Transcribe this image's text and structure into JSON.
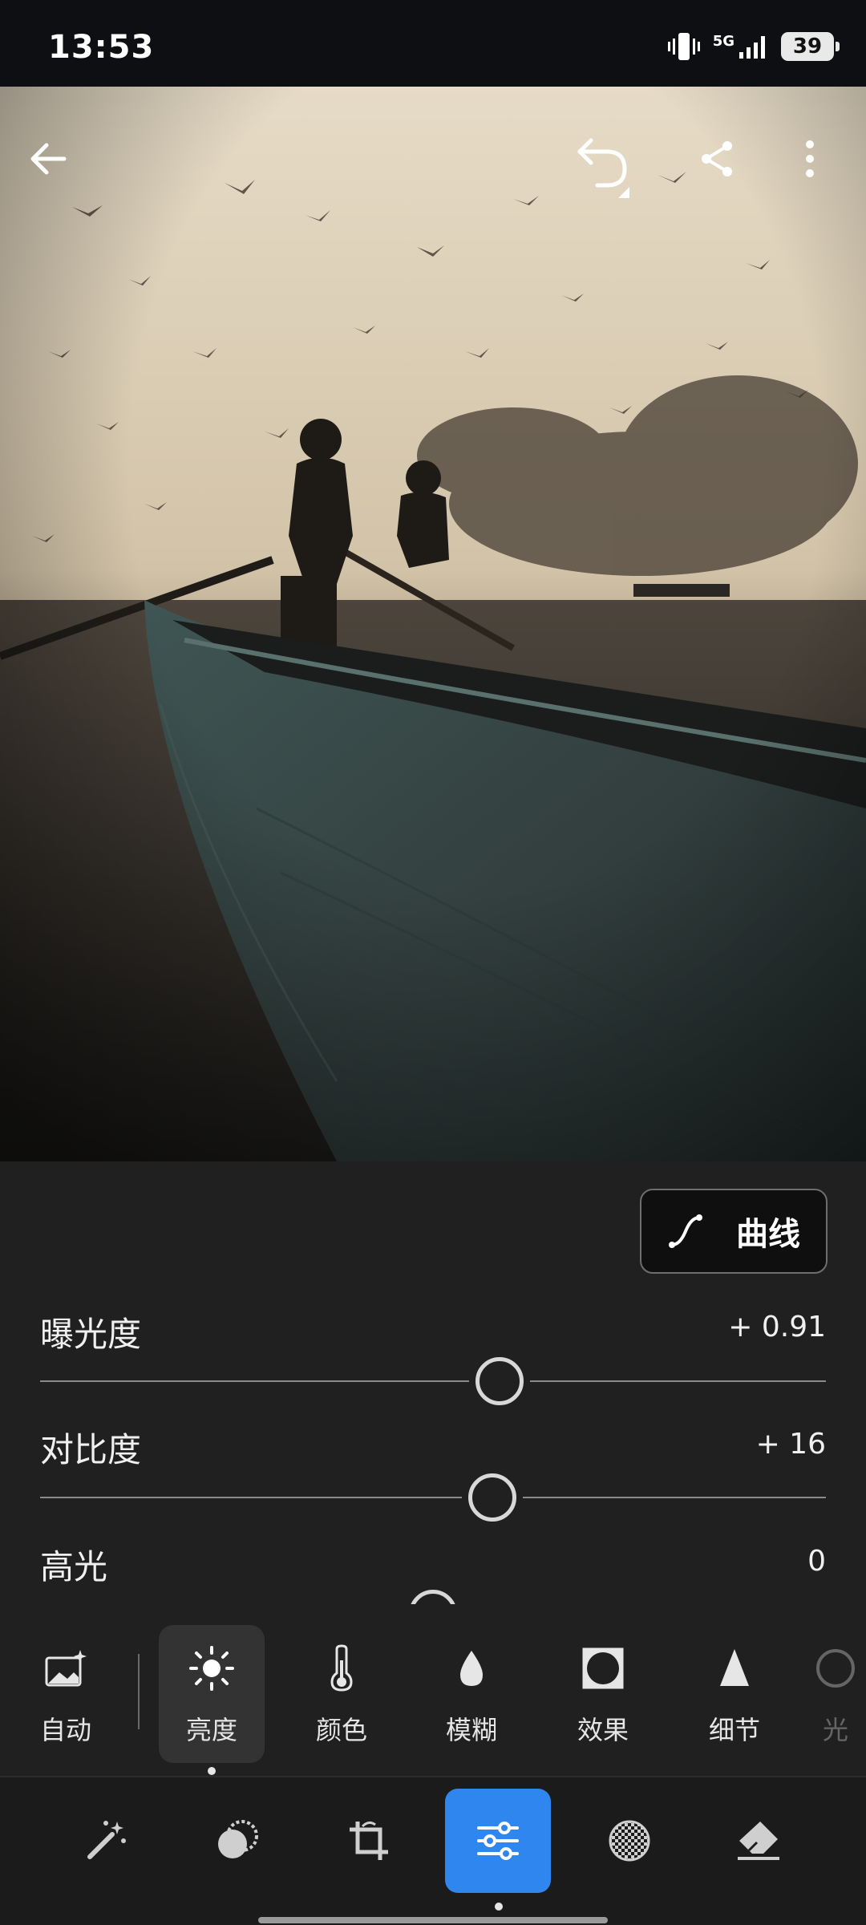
{
  "status_bar": {
    "time": "13:53",
    "network": "5G",
    "battery": "39"
  },
  "photo_toolbar": {
    "back_icon": "arrow-left-icon",
    "undo_icon": "undo-icon",
    "share_icon": "share-icon",
    "more_icon": "more-vertical-icon"
  },
  "curve_button": {
    "label": "曲线",
    "icon": "curve-icon"
  },
  "adjustments": [
    {
      "label": "曝光度",
      "value": "+ 0.91",
      "position": 0.585
    },
    {
      "label": "对比度",
      "value": "+ 16",
      "position": 0.575
    },
    {
      "label": "高光",
      "value": "0",
      "position": 0.5
    }
  ],
  "tools": [
    {
      "label": "自动",
      "icon": "auto-image-icon",
      "active": false
    },
    {
      "label": "亮度",
      "icon": "sun-icon",
      "active": true
    },
    {
      "label": "颜色",
      "icon": "thermometer-icon",
      "active": false
    },
    {
      "label": "模糊",
      "icon": "drop-icon",
      "active": false
    },
    {
      "label": "效果",
      "icon": "vignette-icon",
      "active": false
    },
    {
      "label": "细节",
      "icon": "triangle-icon",
      "active": false
    },
    {
      "label": "光",
      "icon": "optics-icon",
      "active": false
    }
  ],
  "bottom_nav": [
    {
      "icon": "magic-wand-icon",
      "active": false
    },
    {
      "icon": "masking-icon",
      "active": false
    },
    {
      "icon": "crop-icon",
      "active": false
    },
    {
      "icon": "sliders-icon",
      "active": true
    },
    {
      "icon": "presets-icon",
      "active": false
    },
    {
      "icon": "eraser-icon",
      "active": false
    }
  ],
  "colors": {
    "accent": "#2f86ef",
    "panel_bg": "#202020",
    "status_bg": "#0d0f12"
  }
}
